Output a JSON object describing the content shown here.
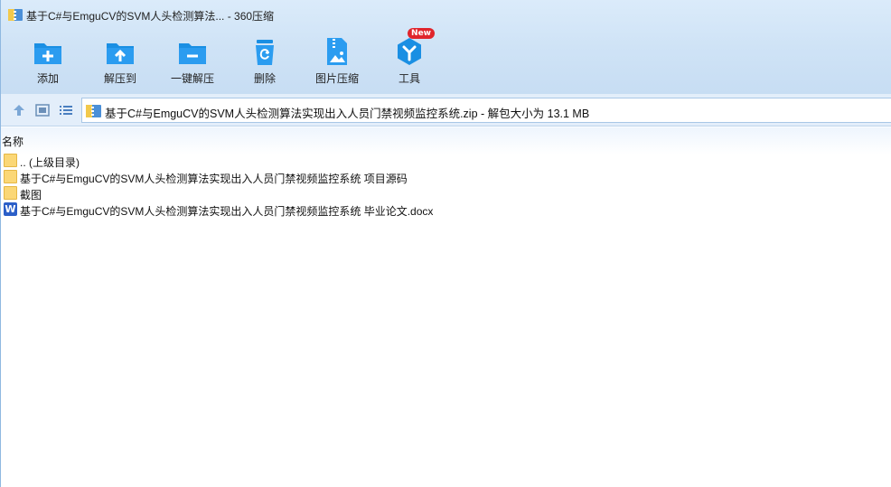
{
  "window": {
    "title": "基于C#与EmguCV的SVM人头检测算法... - 360压缩"
  },
  "toolbar": {
    "items": [
      {
        "label": "添加",
        "icon": "add-icon"
      },
      {
        "label": "解压到",
        "icon": "extract-to-icon"
      },
      {
        "label": "一键解压",
        "icon": "one-click-extract-icon"
      },
      {
        "label": "删除",
        "icon": "delete-icon"
      },
      {
        "label": "图片压缩",
        "icon": "image-compress-icon"
      },
      {
        "label": "工具",
        "icon": "tools-icon",
        "badge": "New"
      }
    ]
  },
  "address": {
    "path": "基于C#与EmguCV的SVM人头检测算法实现出入人员门禁视频监控系统.zip - 解包大小为 13.1 MB"
  },
  "list": {
    "column_name": "名称",
    "items": [
      {
        "name": ".. (上级目录)",
        "type": "folder"
      },
      {
        "name": "基于C#与EmguCV的SVM人头检测算法实现出入人员门禁视频监控系统 项目源码",
        "type": "folder"
      },
      {
        "name": "截图",
        "type": "folder"
      },
      {
        "name": "基于C#与EmguCV的SVM人头检测算法实现出入人员门禁视频监控系统 毕业论文.docx",
        "type": "docx",
        "icon_letter": "W"
      }
    ]
  },
  "colors": {
    "accent": "#1a8fe3",
    "folder": "#fbd776",
    "word": "#2b5fc8",
    "badge": "#e0252c"
  }
}
